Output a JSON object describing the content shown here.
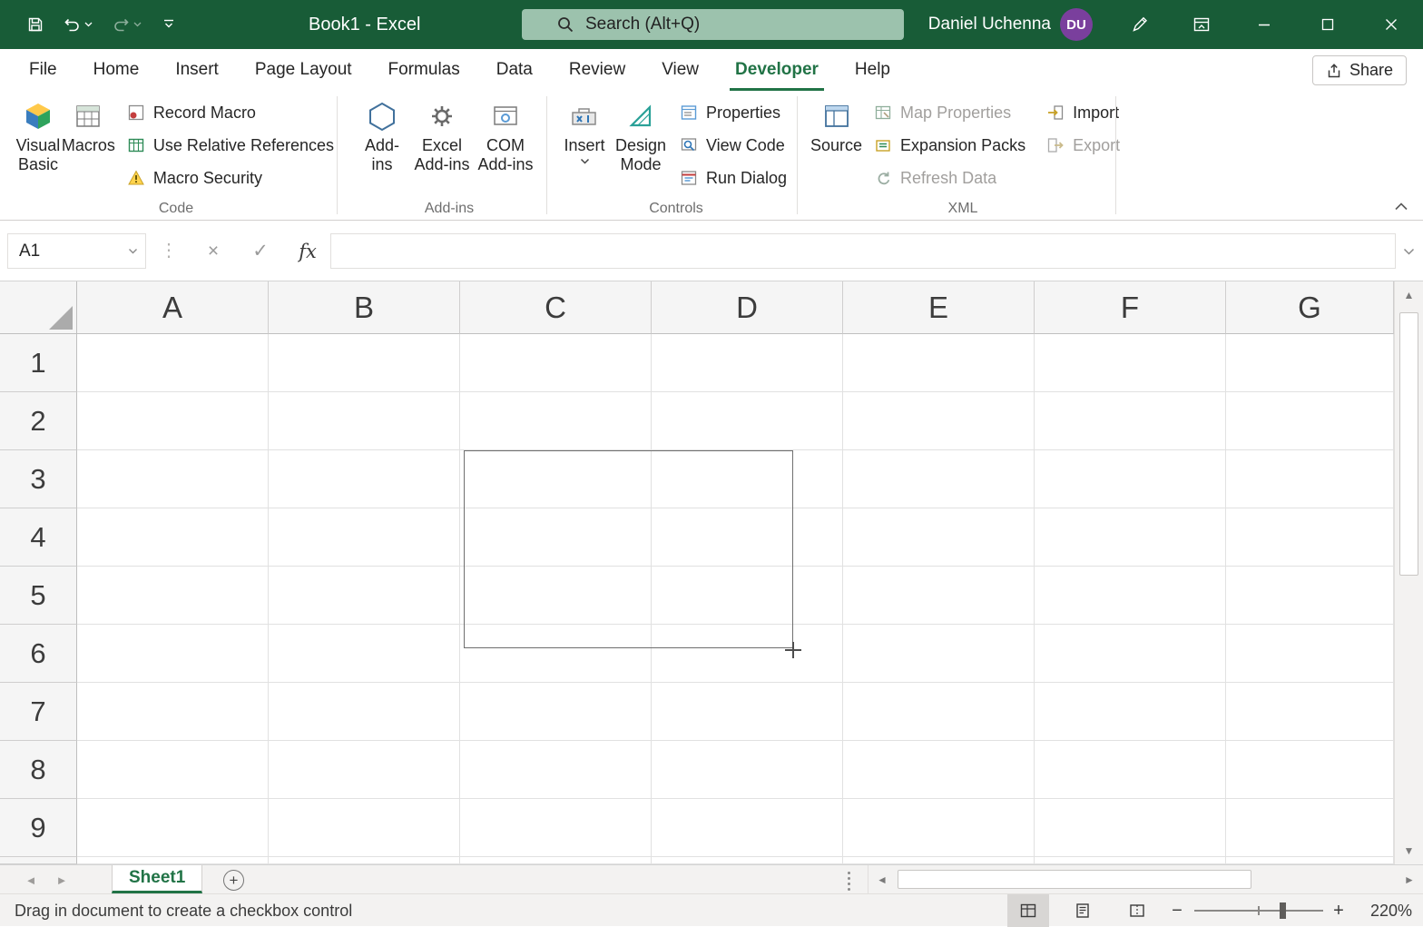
{
  "colors": {
    "titlebar_green": "#185C37",
    "accent_green": "#217346",
    "search_green": "#9CC2AD",
    "avatar_purple": "#7A3F9D",
    "disabled_text": "#A19F9D",
    "status_bg": "#F3F2F1"
  },
  "titlebar": {
    "title": "Book1 - Excel",
    "search_placeholder": "Search (Alt+Q)",
    "user_name": "Daniel Uchenna",
    "user_initials": "DU"
  },
  "ribbon_tabs": {
    "items": [
      {
        "label": "File"
      },
      {
        "label": "Home"
      },
      {
        "label": "Insert"
      },
      {
        "label": "Page Layout"
      },
      {
        "label": "Formulas"
      },
      {
        "label": "Data"
      },
      {
        "label": "Review"
      },
      {
        "label": "View"
      },
      {
        "label": "Developer"
      },
      {
        "label": "Help"
      }
    ],
    "active": "Developer",
    "share": "Share"
  },
  "ribbon": {
    "code": {
      "label": "Code",
      "visual_basic_1": "Visual",
      "visual_basic_2": "Basic",
      "macros": "Macros",
      "record_macro": "Record Macro",
      "use_relative_references": "Use Relative References",
      "macro_security": "Macro Security"
    },
    "addins": {
      "label": "Add-ins",
      "addins_1": "Add-",
      "addins_2": "ins",
      "excel_1": "Excel",
      "excel_2": "Add-ins",
      "com_1": "COM",
      "com_2": "Add-ins"
    },
    "controls": {
      "label": "Controls",
      "insert": "Insert",
      "design_1": "Design",
      "design_2": "Mode",
      "properties": "Properties",
      "view_code": "View Code",
      "run_dialog": "Run Dialog"
    },
    "xml": {
      "label": "XML",
      "source": "Source",
      "map_properties": "Map Properties",
      "expansion_packs": "Expansion Packs",
      "refresh_data": "Refresh Data",
      "import": "Import",
      "export": "Export"
    }
  },
  "formula_bar": {
    "name_box": "A1",
    "formula": ""
  },
  "grid": {
    "columns": [
      "A",
      "B",
      "C",
      "D",
      "E",
      "F",
      "G"
    ],
    "rows": [
      "1",
      "2",
      "3",
      "4",
      "5",
      "6",
      "7",
      "8",
      "9"
    ]
  },
  "sheet_bar": {
    "tab": "Sheet1"
  },
  "status_bar": {
    "message": "Drag in document to create a checkbox control",
    "zoom": "220%"
  },
  "glyphs": {
    "cancel": "×",
    "enter": "✓",
    "fx": "fx",
    "dots_separator": "⋮",
    "add_sheet": "+",
    "zoom_out": "−",
    "zoom_in": "+",
    "scroll_up": "▲",
    "scroll_down": "▼",
    "scroll_left": "◄",
    "scroll_right": "►",
    "prev_sheet": "◄",
    "next_sheet": "►"
  }
}
